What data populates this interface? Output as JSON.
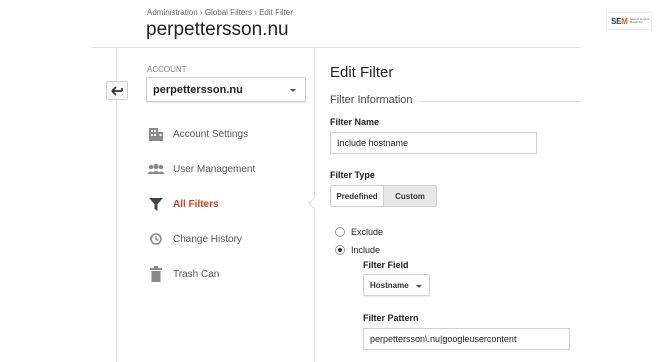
{
  "breadcrumb": {
    "items": [
      "Administration",
      "Global Filters",
      "Edit Filter"
    ],
    "separator": "›"
  },
  "property_title": "perpettersson.nu",
  "logo": {
    "text_a": "SE",
    "text_b": "M",
    "tagline": "Search Engine Magazine"
  },
  "account": {
    "label": "ACCOUNT",
    "selected": "perpettersson.nu"
  },
  "nav": {
    "items": [
      {
        "label": "Account Settings",
        "icon": "building-icon"
      },
      {
        "label": "User Management",
        "icon": "users-icon"
      },
      {
        "label": "All Filters",
        "icon": "filter-icon",
        "active": true
      },
      {
        "label": "Change History",
        "icon": "history-icon"
      },
      {
        "label": "Trash Can",
        "icon": "trash-icon"
      }
    ]
  },
  "edit_filter": {
    "title": "Edit Filter",
    "section": "Filter Information",
    "filter_name_label": "Filter Name",
    "filter_name_value": "Include hostname",
    "filter_type_label": "Filter Type",
    "tabs": {
      "predefined": "Predefined",
      "custom": "Custom",
      "selected": "Custom"
    },
    "radio_exclude": "Exclude",
    "radio_include": "Include",
    "selected_radio": "Include",
    "filter_field_label": "Filter Field",
    "filter_field_value": "Hostname",
    "filter_pattern_label": "Filter Pattern",
    "filter_pattern_value": "perpettersson\\.nu|googleusercontent"
  },
  "colors": {
    "active_nav": "#d9401f",
    "accent_logo": "#e85a1b"
  }
}
